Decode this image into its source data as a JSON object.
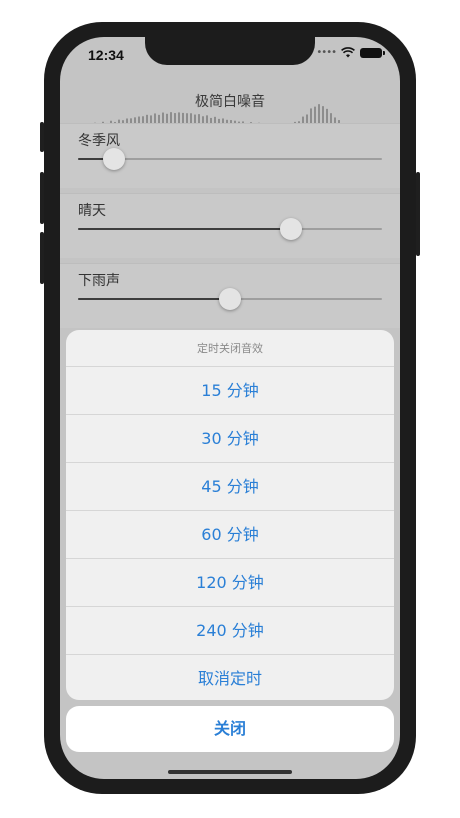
{
  "status_bar": {
    "time": "12:34",
    "signal_icon": "cellular-dots-icon",
    "wifi_icon": "wifi-icon",
    "battery_icon": "battery-icon"
  },
  "app": {
    "title": "极简白噪音"
  },
  "sounds": [
    {
      "label": "冬季风",
      "volume": 0.12
    },
    {
      "label": "晴天",
      "volume": 0.7
    },
    {
      "label": "下雨声",
      "volume": 0.5
    }
  ],
  "action_sheet": {
    "title": "定时关闭音效",
    "options": [
      "15 分钟",
      "30 分钟",
      "45 分钟",
      "60 分钟",
      "120 分钟",
      "240 分钟",
      "取消定时"
    ],
    "cancel_label": "关闭"
  },
  "colors": {
    "accent": "#2a7fd6",
    "sheet_bg": "#f0f0f0",
    "dim_bg": "#c4c4c4"
  }
}
